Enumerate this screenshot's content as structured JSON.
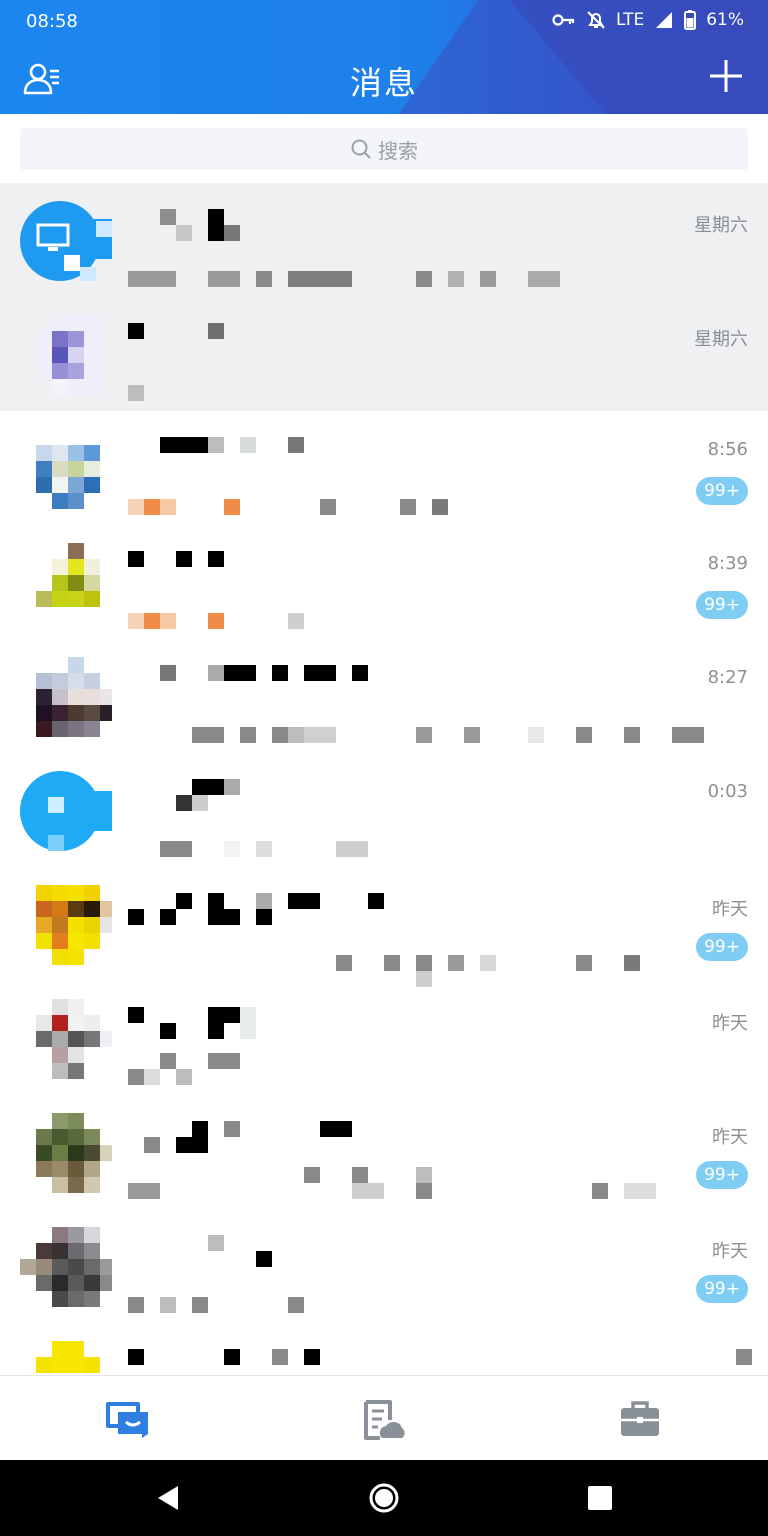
{
  "status_bar": {
    "time": "08:58",
    "network": "LTE",
    "battery": "61%"
  },
  "header": {
    "title": "消息",
    "colors": {
      "primary": "#1b86ef",
      "secondary": "#3653c5"
    }
  },
  "search": {
    "placeholder": "搜索"
  },
  "conversations": [
    {
      "time": "星期六",
      "badge": "",
      "pinned": true
    },
    {
      "time": "星期六",
      "badge": "",
      "pinned": true
    },
    {
      "time": "8:56",
      "badge": "99+",
      "pinned": false
    },
    {
      "time": "8:39",
      "badge": "99+",
      "pinned": false
    },
    {
      "time": "8:27",
      "badge": "",
      "pinned": false
    },
    {
      "time": "0:03",
      "badge": "",
      "pinned": false
    },
    {
      "time": "昨天",
      "badge": "99+",
      "pinned": false
    },
    {
      "time": "昨天",
      "badge": "",
      "pinned": false
    },
    {
      "time": "昨天",
      "badge": "99+",
      "pinned": false
    },
    {
      "time": "昨天",
      "badge": "99+",
      "pinned": false
    },
    {
      "time": "",
      "badge": "",
      "pinned": false
    }
  ],
  "bottom_nav": {
    "items": [
      {
        "icon": "chat-icon",
        "active": true
      },
      {
        "icon": "docs-cloud-icon",
        "active": false
      },
      {
        "icon": "briefcase-icon",
        "active": false
      }
    ]
  },
  "system_nav": {
    "buttons": [
      "back-icon",
      "home-icon",
      "recents-icon"
    ]
  }
}
